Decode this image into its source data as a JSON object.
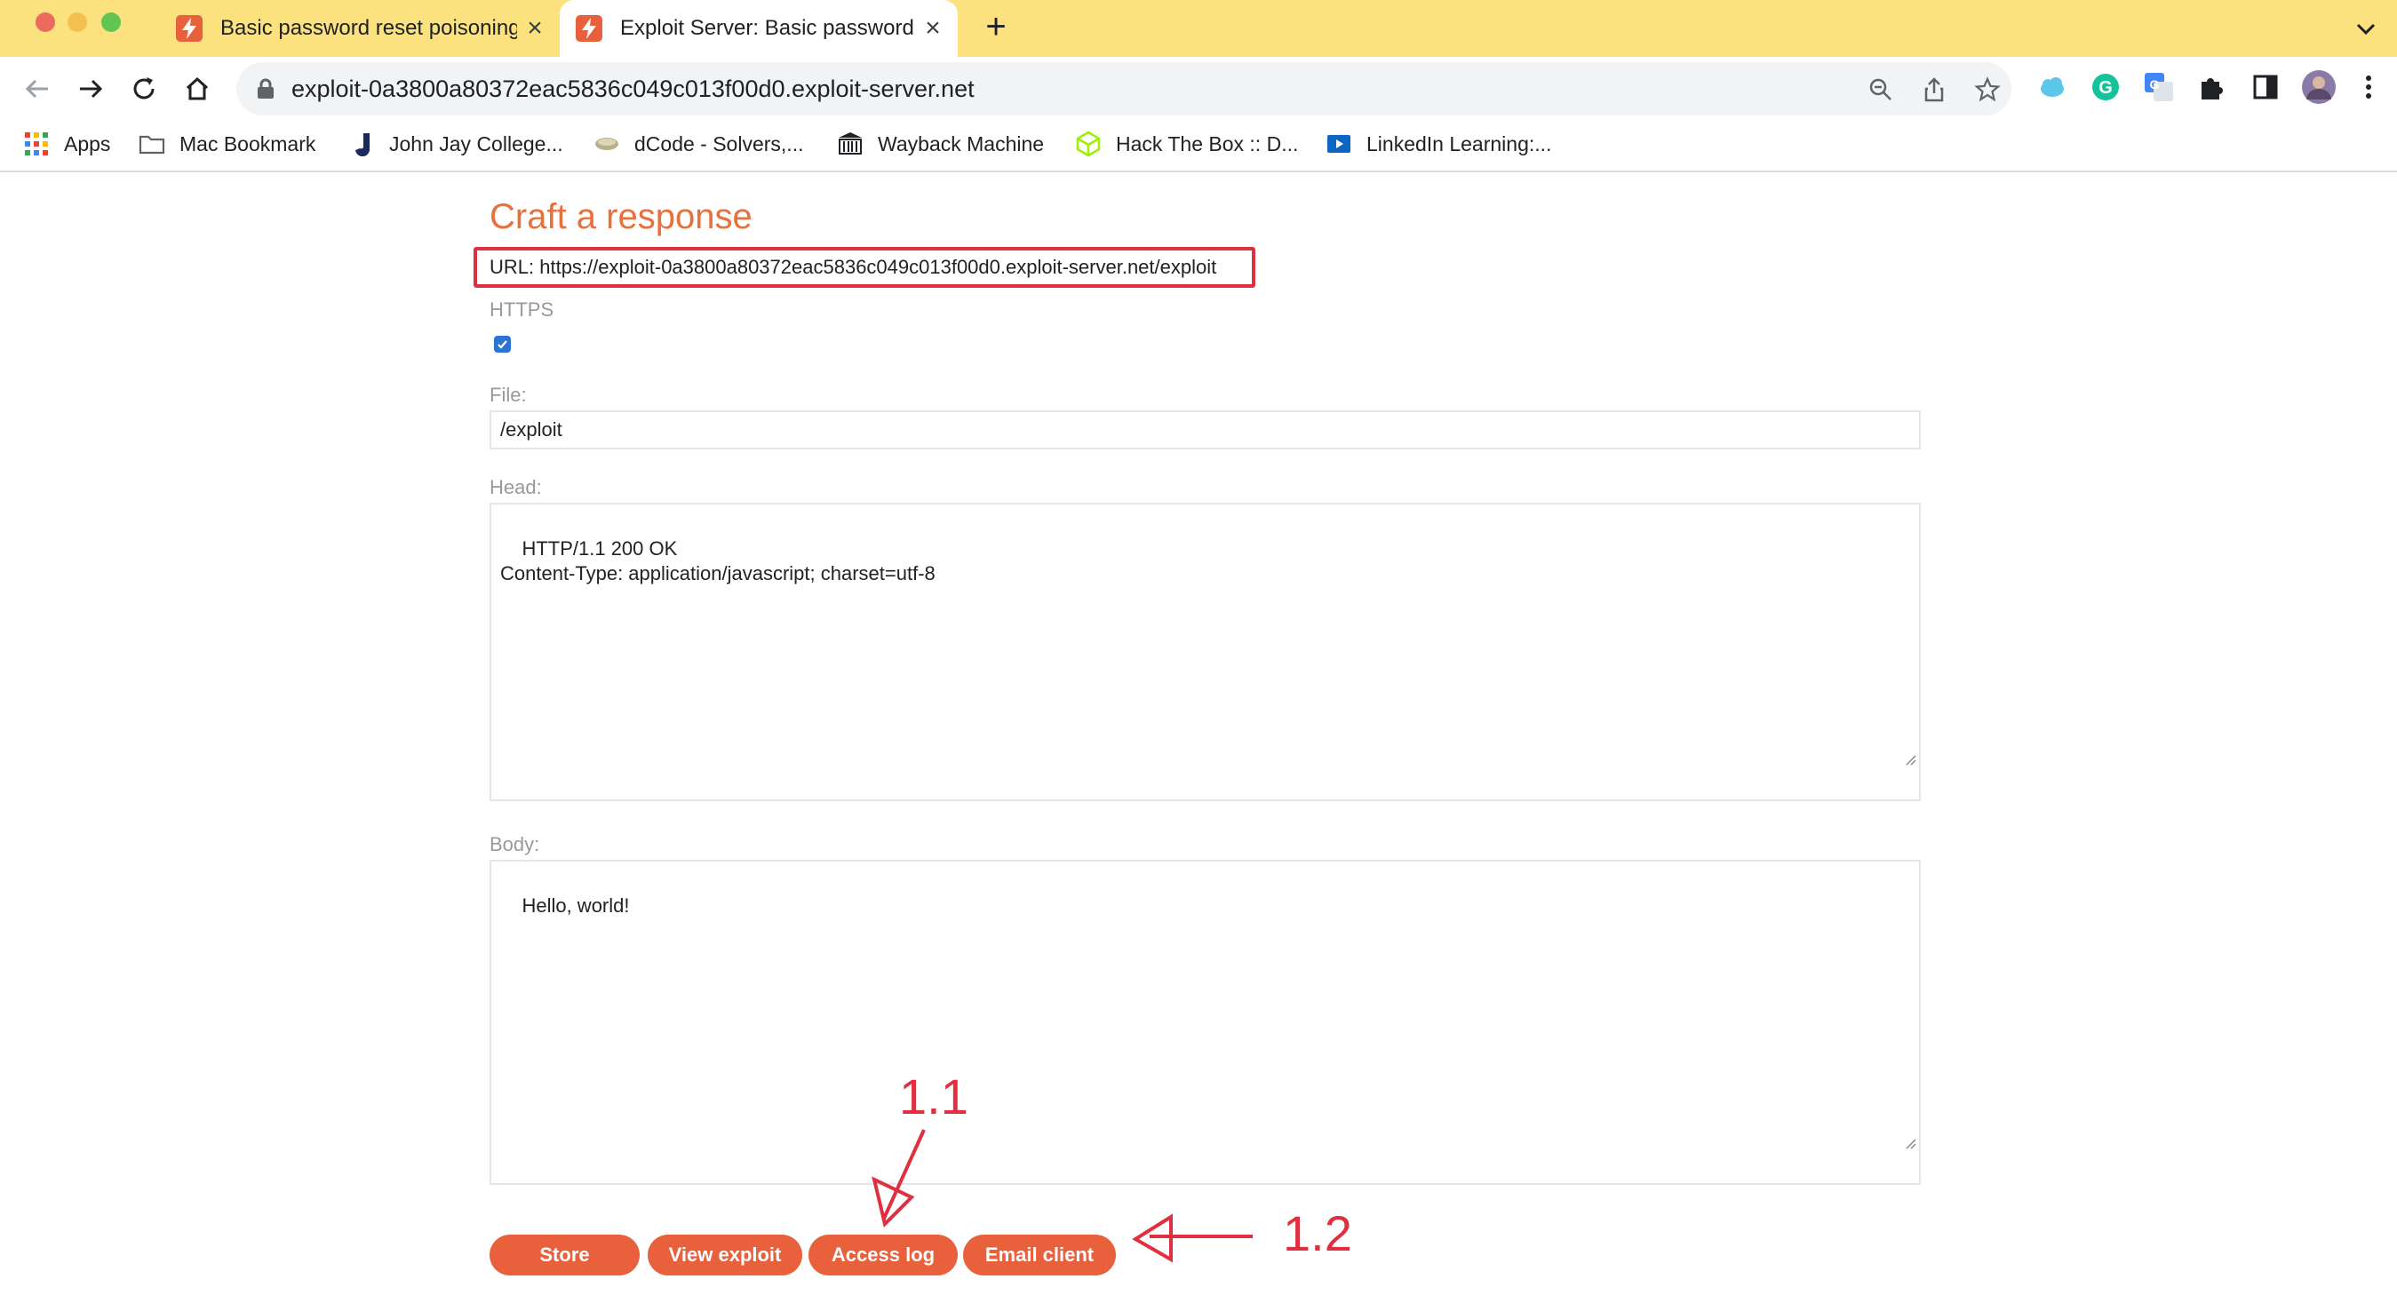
{
  "browser": {
    "tabs": [
      {
        "title": "Basic password reset poisoning",
        "active": false
      },
      {
        "title": "Exploit Server: Basic password reset poisoning",
        "active": true
      }
    ],
    "address": "exploit-0a3800a80372eac5836c049c013f00d0.exploit-server.net",
    "bookmarks": [
      {
        "label": "Apps",
        "icon": "apps-grid-icon"
      },
      {
        "label": "Mac Bookmark",
        "icon": "folder-icon"
      },
      {
        "label": "John Jay College...",
        "icon": "john-jay-icon"
      },
      {
        "label": "dCode - Solvers,...",
        "icon": "dcode-icon"
      },
      {
        "label": "Wayback Machine",
        "icon": "wayback-icon"
      },
      {
        "label": "Hack The Box :: D...",
        "icon": "htb-icon"
      },
      {
        "label": "LinkedIn Learning:...",
        "icon": "linkedin-learning-icon"
      }
    ]
  },
  "form": {
    "heading": "Craft a response",
    "url_line": "URL: https://exploit-0a3800a80372eac5836c049c013f00d0.exploit-server.net/exploit",
    "https_label": "HTTPS",
    "https_checked": true,
    "file_label": "File:",
    "file_value": "/exploit",
    "head_label": "Head:",
    "head_value": "HTTP/1.1 200 OK\nContent-Type: application/javascript; charset=utf-8",
    "body_label": "Body:",
    "body_value": "Hello, world!",
    "buttons": {
      "store": "Store",
      "view_exploit": "View exploit",
      "access_log": "Access log",
      "email_client": "Email client"
    }
  },
  "annotations": {
    "step_1_1": "1.1",
    "step_1_2": "1.2"
  },
  "colors": {
    "accent": "#e8603c",
    "heading": "#e8703c",
    "annotation": "#e0303f",
    "tabstrip": "#fbe27e"
  }
}
